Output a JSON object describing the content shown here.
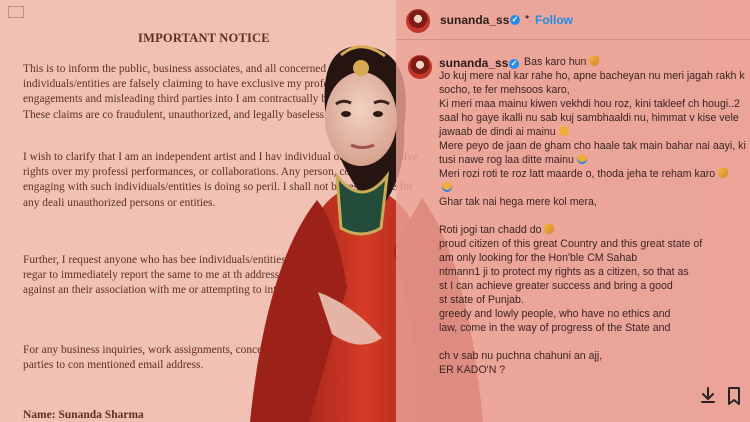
{
  "notice": {
    "title": "IMPORTANT NOTICE",
    "para1": "This is to inform the public, business associates, and all concerned p certain individuals/entities are falsely claiming to have exclusive my professional engagements and misleading third parties into I am contractually bound to them. These claims are co fraudulent, unauthorized, and legally baseless.",
    "para2": "I wish to clarify that I am an independent artist and I hav individual or entity exclusive rights over my professi performances, or collaborations. Any person, company engaging with such individuals/entities is doing so peril. I shall not be responsible for any deali unauthorized persons or entities.",
    "para3": "Further, I request anyone who has bee individuals/entities or has any information regar to immediately report the same to me at th address. Legal action will be taken against an their association with me or attempting to inte engagements.",
    "para4": "For any business inquiries, work assignments, concerning me, I urge all interested parties to con mentioned email address.",
    "name": "Name: Sunanda Sharma"
  },
  "instagram": {
    "handle": "sunanda_ss",
    "follow_label": "Follow",
    "caption_lines": [
      "Bas karo hun",
      "Jo kuj mere nal kar rahe ho, apne bacheyan nu meri jagah rakh k",
      "socho, te fer mehsoos karo,",
      "Ki meri maa mainu kiwen vekhdi hou roz, kini takleef ch hougi..2",
      "saal ho gaye ikalli nu sab kuj sambhaaldi nu, himmat v kise vele",
      "jawaab de dindi ai mainu",
      "Mere peyo de jaan de gham cho haale tak main bahar nai aayi, ki",
      "tusi nawe rog laa ditte mainu",
      "Meri rozi roti te roz latt maarde o, thoda jeha te reham karo",
      "",
      "Ghar tak nai hega mere kol mera,",
      "Roti jogi tan chadd do",
      "proud citizen of this great Country and this great state of",
      "am only looking for the Hon'ble CM Sahab",
      "ntmann1 ji to protect my rights as a citizen, so that as",
      "st I can achieve greater success and bring a good",
      "st state of Punjab.",
      "greedy and lowly people, who have no ethics and",
      "law, come in the way of progress of the State and",
      "",
      "ch v sab nu puchna chahuni an ajj,",
      "ER KADO'N ?"
    ]
  },
  "icons": {
    "download": "download-icon",
    "bookmark": "bookmark-icon",
    "verified": "verified-badge-icon"
  },
  "colors": {
    "background": "#e8a79c",
    "accent": "#1d8fe8",
    "dress": "#c7331e",
    "notice_text": "#5f2f28"
  }
}
